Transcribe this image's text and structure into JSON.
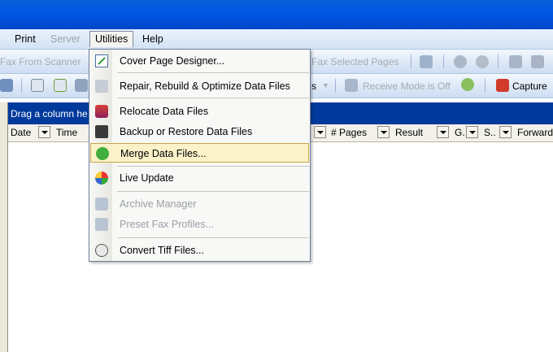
{
  "menubar": {
    "items": [
      {
        "label": "Print",
        "disabled": false
      },
      {
        "label": "Server",
        "disabled": true
      },
      {
        "label": "Utilities",
        "disabled": false
      },
      {
        "label": "Help",
        "disabled": false
      }
    ]
  },
  "toolbar1": {
    "fax_from_scanner": "Fax From Scanner",
    "fax_selected_pages": "Fax Selected Pages"
  },
  "toolbar2": {
    "s_label": "s",
    "receive_mode": "Receive Mode is Off",
    "capture": "Capture"
  },
  "grid": {
    "group_hint": "Drag a column he",
    "columns": {
      "date": "Date",
      "time": "Time",
      "pages": "# Pages",
      "result": "Result",
      "g": "G.",
      "s": "S..",
      "forward": "Forward"
    }
  },
  "utilities_menu": {
    "items": [
      {
        "label": "Cover Page Designer...",
        "icon": "cover-page-icon",
        "disabled": false
      },
      {
        "label": "Repair, Rebuild & Optimize Data Files",
        "icon": "repair-icon",
        "disabled": false
      },
      {
        "label": "Relocate Data Files",
        "icon": "relocate-icon",
        "disabled": false
      },
      {
        "label": "Backup or Restore Data Files",
        "icon": "backup-icon",
        "disabled": false
      },
      {
        "label": "Merge Data Files...",
        "icon": "merge-icon",
        "disabled": false,
        "highlighted": true
      },
      {
        "label": "Live Update",
        "icon": "live-update-icon",
        "disabled": false
      },
      {
        "label": "Archive Manager",
        "icon": "archive-icon",
        "disabled": true
      },
      {
        "label": "Preset Fax Profiles...",
        "icon": "fax-profiles-icon",
        "disabled": true
      },
      {
        "label": "Convert Tiff Files...",
        "icon": "convert-tiff-icon",
        "disabled": false
      }
    ]
  },
  "colors": {
    "titlebar": "#0058e6",
    "groupbar": "#003a9c",
    "highlight": "#fbf2c9"
  }
}
